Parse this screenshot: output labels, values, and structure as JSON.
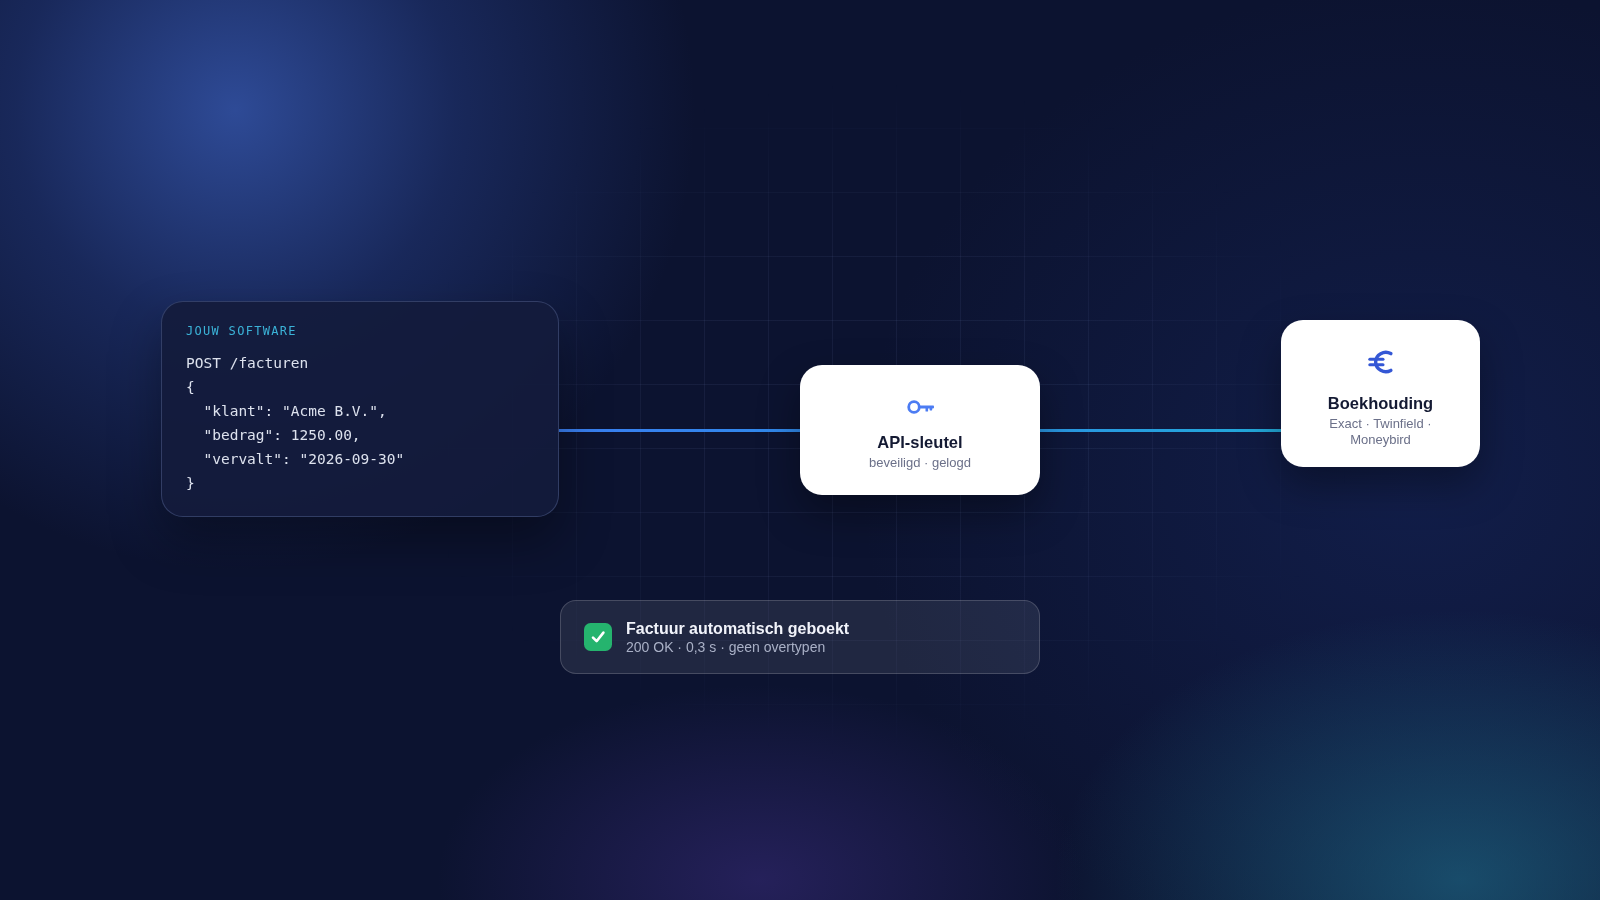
{
  "source": {
    "label": "JOUW SOFTWARE",
    "code_lines": [
      "POST /facturen",
      "{",
      "  \"klant\": \"Acme B.V.\",",
      "  \"bedrag\": 1250.00,",
      "  \"vervalt\": \"2026-09-30\"",
      "}"
    ]
  },
  "nodes": [
    {
      "kind": "gateway",
      "title": "API-sleutel",
      "subtitle": "beveiligd · gelogd"
    },
    {
      "kind": "ledger",
      "title": "Boekhouding",
      "subtitle": "Exact · Twinfield · Moneybird"
    }
  ],
  "status": {
    "title": "Factuur automatisch geboekt",
    "detail": "200 OK · 0,3 s · geen overtypen"
  }
}
